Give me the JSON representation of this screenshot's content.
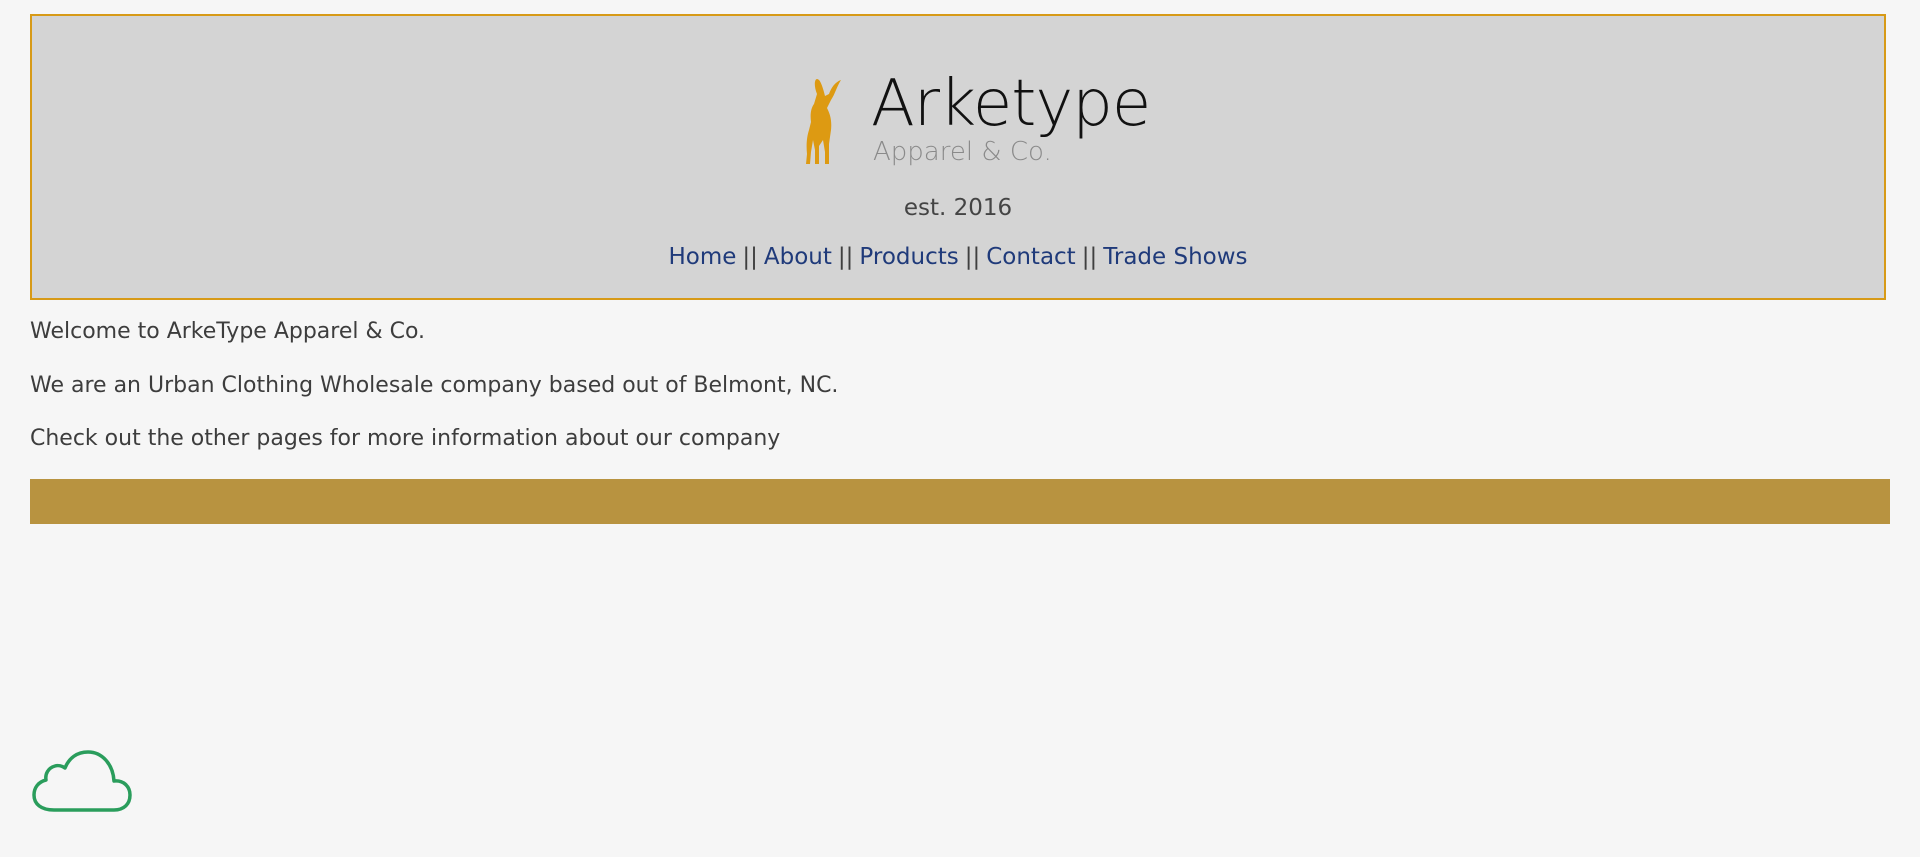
{
  "header": {
    "brand": "Arketype",
    "brand_sub": "Apparel & Co.",
    "est": "est. 2016",
    "nav": {
      "items": [
        {
          "label": "Home"
        },
        {
          "label": "About"
        },
        {
          "label": "Products"
        },
        {
          "label": "Contact"
        },
        {
          "label": "Trade Shows"
        }
      ],
      "separator": "||"
    }
  },
  "content": {
    "lines": [
      "Welcome to ArkeType Apparel & Co.",
      "We are an Urban Clothing Wholesale company based out of Belmont, NC.",
      "Check out the other pages for more information about our company"
    ]
  },
  "icons": {
    "logo": "ibex-logo-icon",
    "cloud": "cloud-icon"
  },
  "colors": {
    "header_bg": "#d4d4d4",
    "header_border": "#d79a17",
    "logo_accent": "#dd9a12",
    "link": "#1f3a7a",
    "footer_bar": "#b89340",
    "cloud": "#2a9d5c"
  }
}
